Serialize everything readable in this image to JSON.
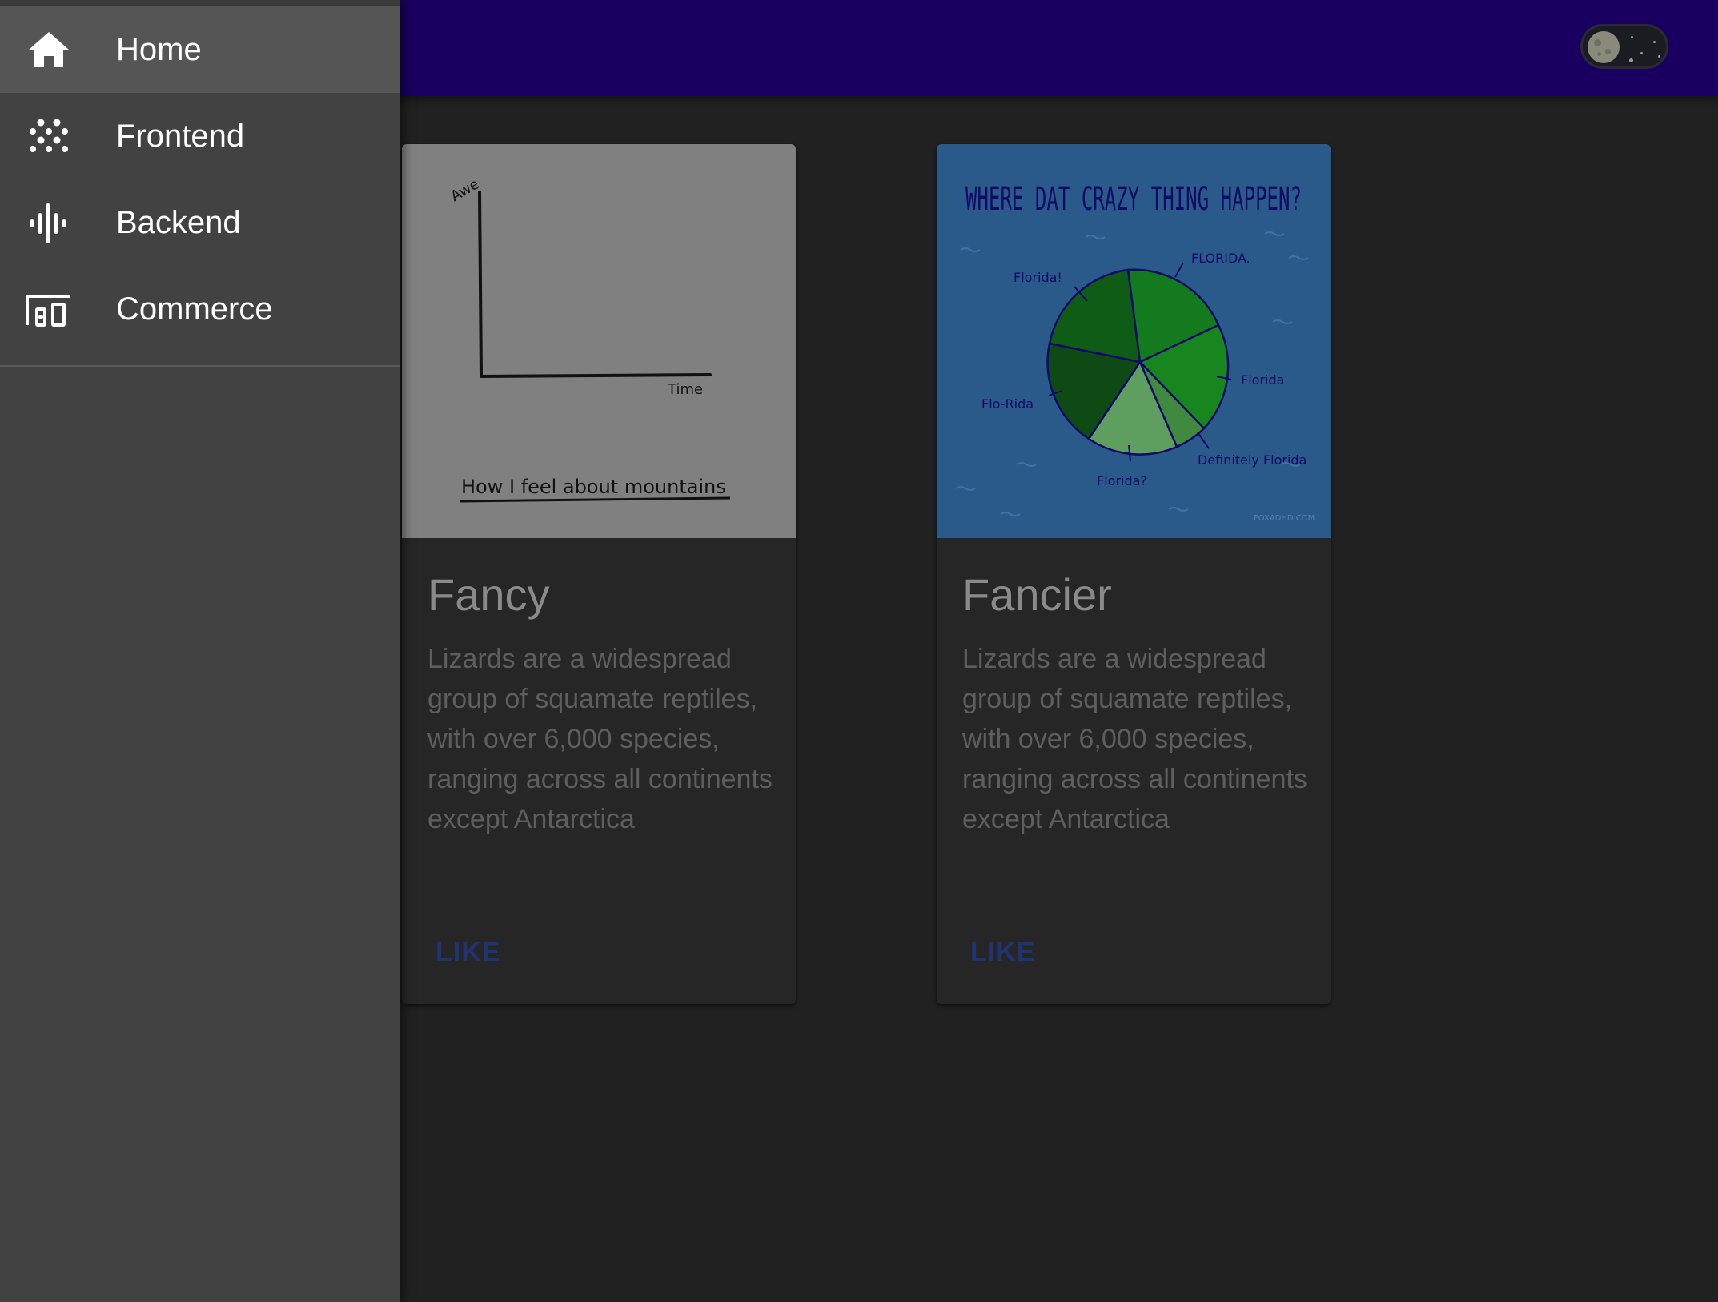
{
  "nav": {
    "items": [
      {
        "label": "Home",
        "icon": "home-icon",
        "active": true
      },
      {
        "label": "Frontend",
        "icon": "dots-grid-icon",
        "active": false
      },
      {
        "label": "Backend",
        "icon": "waveform-icon",
        "active": false
      },
      {
        "label": "Commerce",
        "icon": "devices-icon",
        "active": false
      }
    ]
  },
  "appbar": {
    "color": "#190060",
    "theme_toggle": {
      "state": "dark",
      "icon": "moon-icon"
    }
  },
  "cards": [
    {
      "title": "Fancy",
      "text": "Lizards are a widespread group of squamate reptiles, with over 6,000 species, ranging across all continents except Antarctica",
      "action": "LIKE",
      "image": {
        "y_label": "Awe",
        "x_label": "Time",
        "caption": "How I feel about mountains"
      }
    },
    {
      "title": "Fancier",
      "text": "Lizards are a widespread group of squamate reptiles, with over 6,000 species, ranging across all continents except Antarctica",
      "action": "LIKE",
      "image": {
        "heading": "WHERE DAT CRAZY THING HAPPEN?",
        "slices": [
          "Florida!",
          "FLORIDA.",
          "Florida",
          "Definitely Florida",
          "Florida?",
          "Flo-Rida"
        ],
        "signature": "FOXADHD.COM"
      }
    }
  ]
}
